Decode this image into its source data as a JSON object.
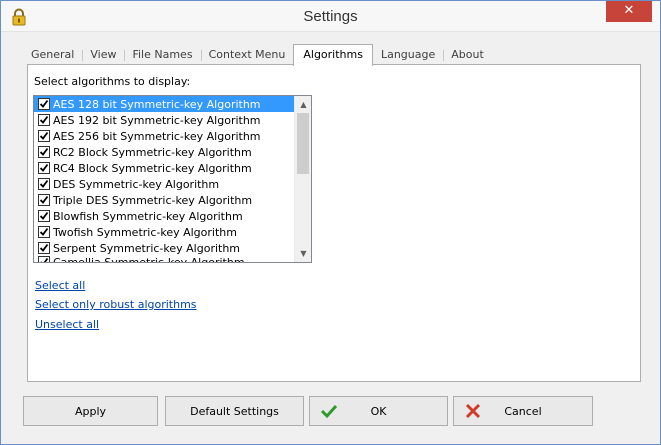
{
  "window": {
    "title": "Settings"
  },
  "tabs": [
    {
      "label": "General"
    },
    {
      "label": "View"
    },
    {
      "label": "File Names"
    },
    {
      "label": "Context Menu"
    },
    {
      "label": "Algorithms"
    },
    {
      "label": "Language"
    },
    {
      "label": "About"
    }
  ],
  "active_tab": "Algorithms",
  "panel": {
    "label": "Select algorithms to display:",
    "algorithms": [
      {
        "label": "AES 128 bit Symmetric-key Algorithm",
        "checked": true,
        "selected": true
      },
      {
        "label": "AES 192 bit Symmetric-key Algorithm",
        "checked": true
      },
      {
        "label": "AES 256 bit Symmetric-key Algorithm",
        "checked": true
      },
      {
        "label": "RC2 Block Symmetric-key Algorithm",
        "checked": true
      },
      {
        "label": "RC4 Block Symmetric-key Algorithm",
        "checked": true
      },
      {
        "label": "DES Symmetric-key Algorithm",
        "checked": true
      },
      {
        "label": "Triple DES Symmetric-key Algorithm",
        "checked": true
      },
      {
        "label": "Blowfish Symmetric-key Algorithm",
        "checked": true
      },
      {
        "label": "Twofish Symmetric-key Algorithm",
        "checked": true
      },
      {
        "label": "Serpent Symmetric-key Algorithm",
        "checked": true
      },
      {
        "label": "Camellia Symmetric-key Algorithm",
        "checked": true
      }
    ],
    "links": {
      "select_all": "Select all",
      "select_robust": "Select only robust algorithms",
      "unselect_all": "Unselect all"
    }
  },
  "buttons": {
    "apply": "Apply",
    "default_settings": "Default Settings",
    "ok": "OK",
    "cancel": "Cancel"
  },
  "icons": {
    "title": "lock-icon",
    "close": "close-icon",
    "ok": "checkmark-icon",
    "cancel": "x-icon",
    "scroll_up": "chevron-up-icon",
    "scroll_down": "chevron-down-icon"
  },
  "colors": {
    "selection": "#3399ff",
    "link": "#0044aa",
    "close_button": "#c7443a",
    "ok_check": "#2e9a2e",
    "cancel_x": "#d23a2a"
  }
}
